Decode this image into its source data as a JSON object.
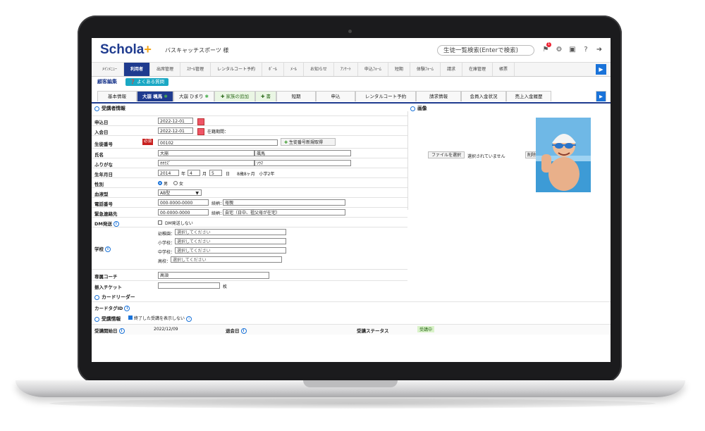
{
  "header": {
    "logo": "Schola",
    "logo_plus": "+",
    "school_name": "バスキャッチスポーツ 様",
    "search_placeholder": "生徒一覧検索(Enterで検索)",
    "notify_count": "1"
  },
  "nav": {
    "items": [
      "ﾒｲﾝﾒﾆｭｰ",
      "利用者",
      "出席管理",
      "ｽｸｰﾙ管理",
      "レンタルコート予約",
      "ﾎﾞｰﾙ",
      "ﾒｰﾙ",
      "お知らせ",
      "ｱﾝｹｰﾄ",
      "申込ﾌｫｰﾑ",
      "短期",
      "体験ﾌｫｰﾑ",
      "請求",
      "在庫管理",
      "帳票"
    ]
  },
  "sub": {
    "title": "顧客編集",
    "faq": "よくある質問"
  },
  "tabs": [
    "基本情報",
    "大崩 颯馬",
    "大崩 ひまり",
    "家族の追加",
    "書",
    "短期",
    "申込",
    "レンタルコート予約",
    "請求情報",
    "会員入金状況",
    "売上入金履歴"
  ],
  "sections": {
    "student": "受講者情報",
    "image": "画像",
    "card": "カードリーダー",
    "course": "受講情報"
  },
  "form": {
    "apply_date_label": "申込日",
    "apply_date": "2022-12-01",
    "join_date_label": "入会日",
    "join_date": "2022-12-01",
    "join_period_label": "在籍期間：",
    "student_no_label": "生徒番号",
    "required": "必須",
    "student_no": "00102",
    "new_no_btn": "生徒番号新規取得",
    "name_label": "氏名",
    "last_name": "大崩",
    "first_name": "颯馬",
    "kana_label": "ふりがな",
    "last_kana": "ｵｵｸｽﾞ",
    "first_kana": "ｿｳﾏ",
    "birth_label": "生年月日",
    "birth_year": "2014",
    "year_unit": "年",
    "birth_month": "4",
    "month_unit": "月",
    "birth_day": "5",
    "day_unit": "日",
    "age": "8歳8ヶ月　小学2年",
    "gender_label": "性別",
    "male": "男",
    "female": "女",
    "blood_label": "血液型",
    "blood": "AB型",
    "phone_label": "電話番号",
    "phone": "000-0000-0000",
    "relation_label": "続柄：",
    "phone_relation": "母親",
    "emergency_label": "緊急連絡先",
    "emergency": "00-0000-0000",
    "emergency_relation": "自宅（日中、祖父母が在宅）",
    "dm_label": "DM発送",
    "dm_option": "DM発送しない",
    "school_label": "学校",
    "kinder_label": "幼稚園：",
    "elem_label": "小学校：",
    "middle_label": "中学校：",
    "high_label": "高校：",
    "select_placeholder": "選択してください",
    "coach_label": "専属コーチ",
    "coach": "高須",
    "ticket_label": "振入チケット",
    "ticket_unit": "枚",
    "cardtag_label": "カードタグID",
    "hide_finished": "終了した受講を表示しない",
    "course_start_label": "受講開始日",
    "course_start": "2022/12/09",
    "leave_label": "退会日",
    "status_label": "受講ステータス",
    "status": "受講中"
  },
  "image": {
    "file_btn": "ファイルを選択",
    "no_file": "選択されていません",
    "delete": "削除"
  },
  "colors": {
    "brand": "#1f3b8f",
    "accent": "#1a73d9",
    "required": "#c8201f",
    "faq": "#1aa8c4"
  }
}
